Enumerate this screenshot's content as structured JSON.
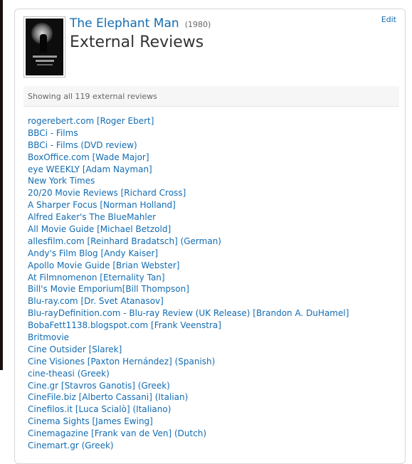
{
  "movie": {
    "title": "The Elephant Man",
    "year": "(1980)"
  },
  "page_title": "External Reviews",
  "edit_label": "Edit",
  "summary": "Showing all 119 external reviews",
  "reviews": [
    "rogerebert.com [Roger Ebert]",
    "BBCi - Films",
    "BBCi - Films (DVD review)",
    "BoxOffice.com [Wade Major]",
    "eye WEEKLY [Adam Nayman]",
    "New York Times",
    "20/20 Movie Reviews [Richard Cross]",
    "A Sharper Focus [Norman Holland]",
    "Alfred Eaker's The BlueMahler",
    "All Movie Guide [Michael Betzold]",
    "allesfilm.com [Reinhard Bradatsch] (German)",
    "Andy's Film Blog [Andy Kaiser]",
    "Apollo Movie Guide [Brian Webster]",
    "At Filmnomenon [Eternality Tan]",
    "Bill's Movie Emporium[Bill Thompson]",
    "Blu-ray.com [Dr. Svet Atanasov]",
    "Blu-rayDefinition.com - Blu-ray Review (UK Release) [Brandon A. DuHamel]",
    "BobaFett1138.blogspot.com [Frank Veenstra]",
    "Britmovie",
    "Cine Outsider [Slarek]",
    "Cine Visiones [Paxton Hernández] (Spanish)",
    "cine-theasi (Greek)",
    "Cine.gr [Stavros Ganotis] (Greek)",
    "CineFile.biz [Alberto Cassani] (Italian)",
    "Cinefilos.it [Luca Scialò] (Italiano)",
    "Cinema Sights [James Ewing]",
    "Cinemagazine [Frank van de Ven] (Dutch)",
    "Cinemart.gr (Greek)"
  ],
  "colors": {
    "link": "#136cb2",
    "text": "#333333",
    "muted": "#666666"
  }
}
